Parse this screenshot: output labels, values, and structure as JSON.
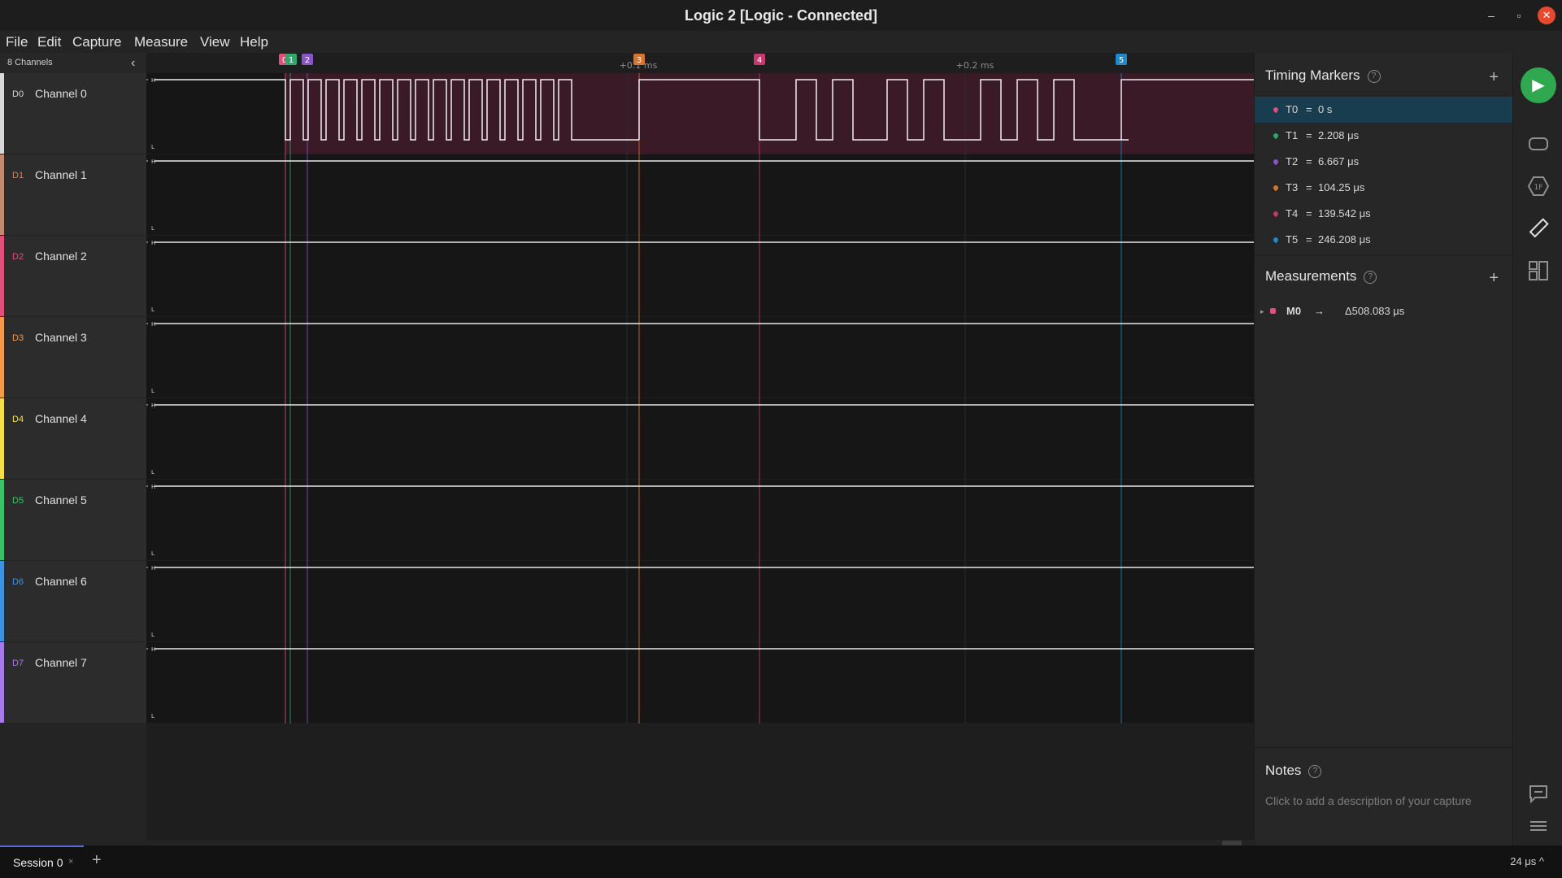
{
  "window": {
    "title": "Logic 2 [Logic - Connected]"
  },
  "menu": [
    "File",
    "Edit",
    "Capture",
    "Measure",
    "View",
    "Help"
  ],
  "channels_header": {
    "count_label": "8 Channels"
  },
  "channels": [
    {
      "id": "D0",
      "name": "Channel 0",
      "color": "#d9d9d9"
    },
    {
      "id": "D1",
      "name": "Channel 1",
      "color": "#c48a70"
    },
    {
      "id": "D2",
      "name": "Channel 2",
      "color": "#e0507a"
    },
    {
      "id": "D3",
      "name": "Channel 3",
      "color": "#f29a4a"
    },
    {
      "id": "D4",
      "name": "Channel 4",
      "color": "#f5e04a"
    },
    {
      "id": "D5",
      "name": "Channel 5",
      "color": "#39c26a"
    },
    {
      "id": "D6",
      "name": "Channel 6",
      "color": "#3f92e0"
    },
    {
      "id": "D7",
      "name": "Channel 7",
      "color": "#a67ae8"
    }
  ],
  "timeline": {
    "time_labels": [
      "+0.1 ms",
      "+0.2 ms"
    ],
    "markers": [
      {
        "label": "0",
        "color": "#e0507a"
      },
      {
        "label": "1",
        "color": "#2ea86a"
      },
      {
        "label": "2",
        "color": "#8a55c9"
      },
      {
        "label": "3",
        "color": "#d9742c"
      },
      {
        "label": "4",
        "color": "#c43a6e"
      },
      {
        "label": "5",
        "color": "#1f8ac9"
      }
    ],
    "level_high": "H",
    "level_low": "L"
  },
  "timing_markers": {
    "title": "Timing Markers",
    "help": "?",
    "add": "+",
    "items": [
      {
        "name": "T0",
        "value": "0 s",
        "color": "#e0507a"
      },
      {
        "name": "T1",
        "value": "2.208 μs",
        "color": "#2ea86a"
      },
      {
        "name": "T2",
        "value": "6.667 μs",
        "color": "#8a55c9"
      },
      {
        "name": "T3",
        "value": "104.25 μs",
        "color": "#d9742c"
      },
      {
        "name": "T4",
        "value": "139.542 μs",
        "color": "#c43a6e"
      },
      {
        "name": "T5",
        "value": "246.208 μs",
        "color": "#1f8ac9"
      }
    ]
  },
  "measurements": {
    "title": "Measurements",
    "help": "?",
    "add": "+",
    "items": [
      {
        "name": "M0",
        "arrow": "→",
        "value": "Δ508.083 μs",
        "color": "#e0507a"
      }
    ]
  },
  "notes": {
    "title": "Notes",
    "help": "?",
    "placeholder": "Click to add a description of your capture"
  },
  "bottom": {
    "session_label": "Session 0",
    "close": "×",
    "add": "+",
    "zoom": "24 μs ^"
  },
  "sidebar_icons": [
    "play-icon",
    "analyzers-icon",
    "trigger-icon",
    "ruler-icon",
    "extensions-icon",
    "comment-icon",
    "menu-icon"
  ]
}
